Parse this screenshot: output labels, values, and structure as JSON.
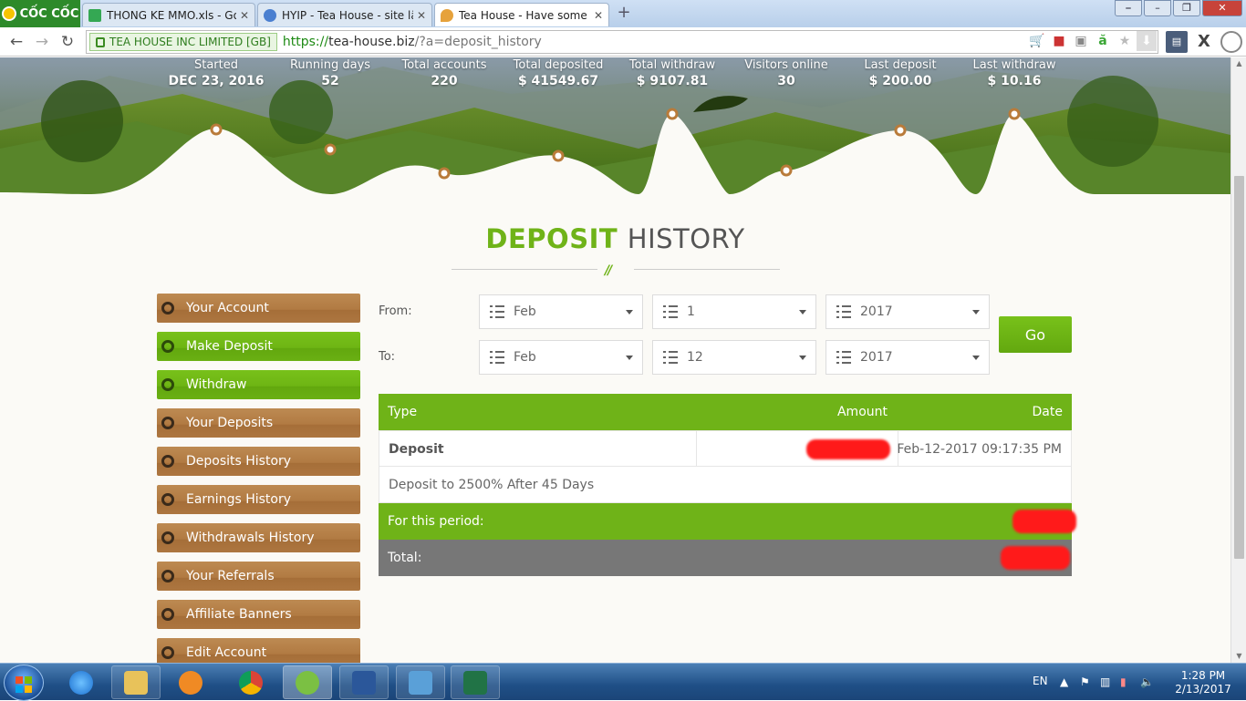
{
  "browser": {
    "brand": "CỐC CỐC",
    "tabs": [
      {
        "label": "THONG KE MMO.xls - Goo",
        "icon_color": "#34a853",
        "active": false
      },
      {
        "label": "HYIP - Tea House - site lãi",
        "icon_color": "#4a7fd0",
        "active": false
      },
      {
        "label": "Tea House - Have some te",
        "icon_color": "#e6a23c",
        "active": true
      }
    ],
    "close_glyph": "✕",
    "new_tab_glyph": "+",
    "security_label": "TEA HOUSE INC LIMITED [GB]",
    "url_scheme": "https://",
    "url_host": "tea-house.biz",
    "url_path": "/?a=deposit_history"
  },
  "stats": [
    {
      "label": "Started",
      "value": "DEC 23, 2016"
    },
    {
      "label": "Running days",
      "value": "52"
    },
    {
      "label": "Total accounts",
      "value": "220"
    },
    {
      "label": "Total deposited",
      "value": "$ 41549.67"
    },
    {
      "label": "Total withdraw",
      "value": "$ 9107.81"
    },
    {
      "label": "Visitors online",
      "value": "30"
    },
    {
      "label": "Last deposit",
      "value": "$ 200.00"
    },
    {
      "label": "Last withdraw",
      "value": "$ 10.16"
    }
  ],
  "heading": {
    "accent": "DEPOSIT",
    "rest": "HISTORY",
    "mark": "//"
  },
  "menu": [
    {
      "label": "Your Account",
      "style": "brown"
    },
    {
      "label": "Make Deposit",
      "style": "green"
    },
    {
      "label": "Withdraw",
      "style": "green"
    },
    {
      "label": "Your Deposits",
      "style": "brown"
    },
    {
      "label": "Deposits History",
      "style": "brown"
    },
    {
      "label": "Earnings History",
      "style": "brown"
    },
    {
      "label": "Withdrawals History",
      "style": "brown"
    },
    {
      "label": "Your Referrals",
      "style": "brown"
    },
    {
      "label": "Affiliate Banners",
      "style": "brown"
    },
    {
      "label": "Edit Account",
      "style": "brown"
    }
  ],
  "filter": {
    "from_label": "From:",
    "to_label": "To:",
    "from": {
      "month": "Feb",
      "day": "1",
      "year": "2017"
    },
    "to": {
      "month": "Feb",
      "day": "12",
      "year": "2017"
    },
    "go_label": "Go"
  },
  "table": {
    "headers": {
      "type": "Type",
      "amount": "Amount",
      "date": "Date"
    },
    "row": {
      "type": "Deposit",
      "amount_redacted": true,
      "date": "Feb-12-2017 09:17:35 PM"
    },
    "plan": "Deposit to 2500% After 45 Days",
    "period_label": "For this period:",
    "total_label": "Total:"
  },
  "taskbar": {
    "lang": "EN",
    "time": "1:28 PM",
    "date": "2/13/2017"
  },
  "colors": {
    "accent_green": "#6fb318",
    "menu_brown": "#b17a42",
    "total_gray": "#777777"
  }
}
